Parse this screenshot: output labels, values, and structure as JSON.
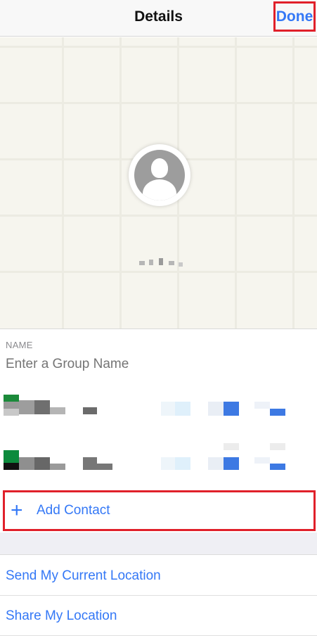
{
  "navbar": {
    "title": "Details",
    "done_label": "Done"
  },
  "name_section": {
    "label": "NAME",
    "placeholder": "Enter a Group Name"
  },
  "add_contact": {
    "label": "Add Contact",
    "icon": "plus-icon"
  },
  "location_actions": [
    {
      "label": "Send My Current Location"
    },
    {
      "label": "Share My Location"
    }
  ],
  "colors": {
    "accent": "#3478f6",
    "highlight_border": "#e0202a",
    "map_bg": "#f6f5ee"
  }
}
